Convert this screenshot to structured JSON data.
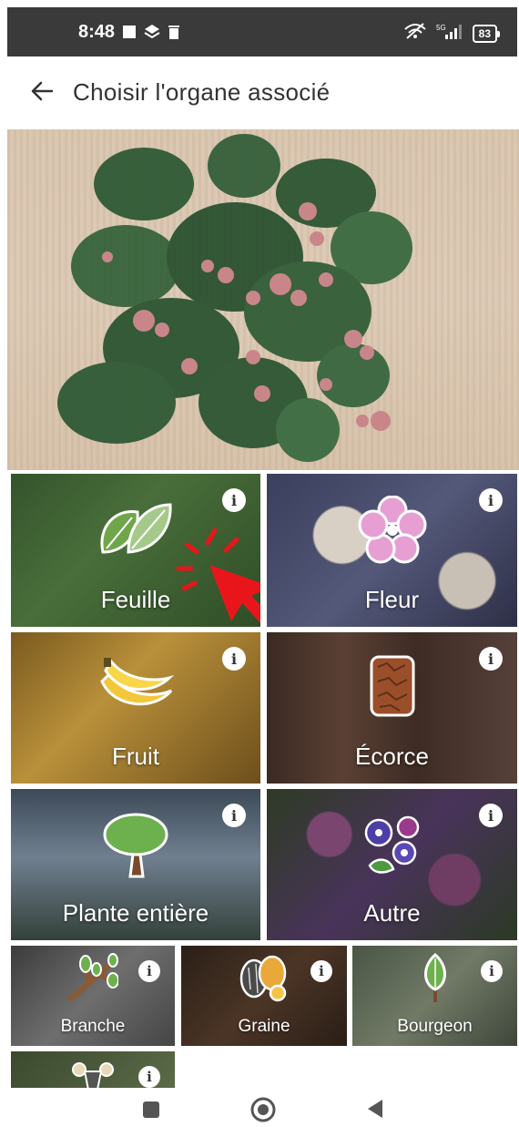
{
  "status_bar": {
    "time": "8:48",
    "battery": "83",
    "icons": [
      "square-icon",
      "layers-icon",
      "trash-icon",
      "wifi-off-icon",
      "signal-5g-icon",
      "battery-icon"
    ]
  },
  "app_bar": {
    "back_icon": "arrow-left-icon",
    "title": "Choisir l'organe associé"
  },
  "organs": {
    "feuille": {
      "label": "Feuille",
      "icon": "leaves-icon"
    },
    "fleur": {
      "label": "Fleur",
      "icon": "flower-icon"
    },
    "fruit": {
      "label": "Fruit",
      "icon": "banana-icon"
    },
    "ecorce": {
      "label": "Écorce",
      "icon": "bark-icon"
    },
    "plante": {
      "label": "Plante entière",
      "icon": "tree-icon"
    },
    "autre": {
      "label": "Autre",
      "icon": "flowers-icon"
    },
    "branche": {
      "label": "Branche",
      "icon": "branch-icon"
    },
    "graine": {
      "label": "Graine",
      "icon": "seeds-icon"
    },
    "bourgeon": {
      "label": "Bourgeon",
      "icon": "bud-icon"
    }
  },
  "colors": {
    "accent_pointer": "#e8161a",
    "title_text": "#333333"
  },
  "nav_bar": {
    "icons": [
      "recents-icon",
      "home-icon",
      "back-icon"
    ]
  }
}
